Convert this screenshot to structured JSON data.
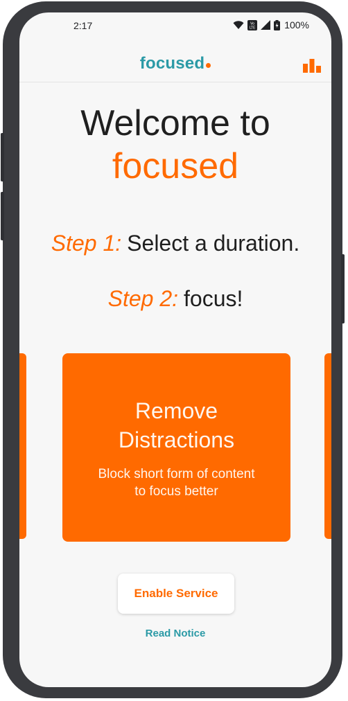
{
  "status_bar": {
    "time": "2:17",
    "battery_pct": "100%",
    "icons": [
      "wifi-icon",
      "volte-icon",
      "signal-icon",
      "battery-icon"
    ]
  },
  "app_bar": {
    "brand": "focused",
    "brand_dot_color": "#ff6a00",
    "action_icon": "bar-chart-icon"
  },
  "welcome": {
    "line1": "Welcome to",
    "line2": "focused"
  },
  "steps": [
    {
      "prefix": "Step 1:",
      "text": "Select a duration."
    },
    {
      "prefix": "Step 2:",
      "text": "focus!"
    }
  ],
  "card": {
    "title": "Remove\nDistractions",
    "subtitle": "Block short form of content\nto focus better"
  },
  "actions": {
    "enable_label": "Enable Service",
    "notice_label": "Read Notice"
  },
  "colors": {
    "accent_orange": "#ff6a00",
    "brand_teal": "#2b9aa6",
    "background": "#f7f7f7"
  }
}
